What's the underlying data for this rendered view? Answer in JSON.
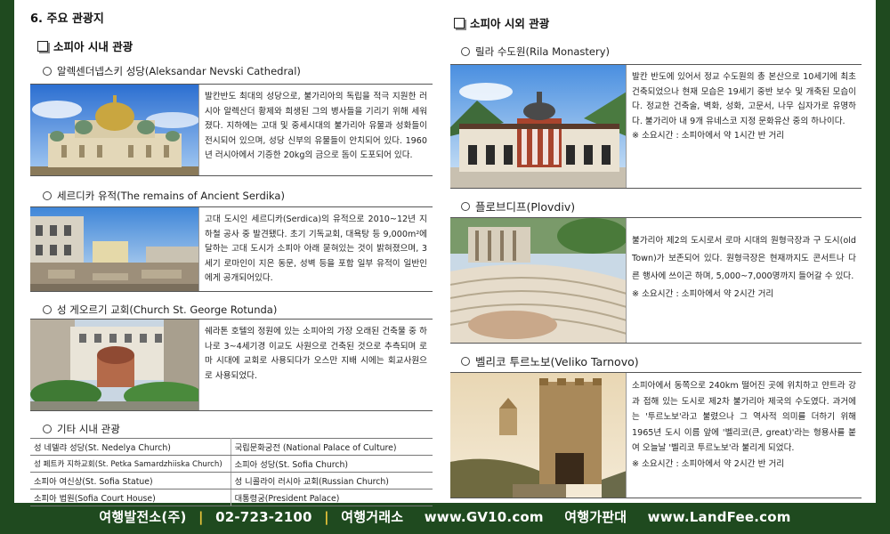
{
  "left": {
    "section_title": "6. 주요 관광지",
    "sub_title": "소피아 시내 관광",
    "items": [
      {
        "title": "알렉센더넵스키 성당(Aleksandar Nevski Cathedral)",
        "desc": "발칸반도 최대의 성당으로, 불가리아의 독립을 적극 지원한 러시아 알렉산더 황제와 희생된 그의 병사들을 기리기 위해 세워졌다. 지하에는 고대 및 중세시대의 불가리아 유물과 성화들이 전시되어 있으며, 성당 신부의 유물들이 안치되어 있다. 1960년 러시아에서 기증한 20kg의 금으로 돔이 도포되어 있다."
      },
      {
        "title": "세르디카 유적(The remains of Ancient Serdika)",
        "desc": "고대 도시인 세르디카(Serdica)의 유적으로 2010~12년 지하철 공사 중 발견됐다. 초기 기독교회, 대욕탕 등 9,000m²에 달하는 고대 도시가 소피아 아래 묻혀있는 것이 밝혀졌으며, 3세기 로마인이 지은 동문, 성벽 등을 포함 일부 유적이 일반인에게 공개되어있다."
      },
      {
        "title": "성 게오르기 교회(Church St. George Rotunda)",
        "desc": "쉐라톤 호텔의 정원에 있는 소피아의 가장 오래된 건축물 중 하나로 3~4세기경 이교도 사원으로 건축된 것으로 추측되며 로마 시대에 교회로 사용되다가 오스만 지배 시에는 회교사원으로 사용되었다."
      }
    ],
    "etc_title": "기타 시내 관광",
    "etc_rows": [
      [
        "성 네델랴 성당(St. Nedelya Church)",
        "국립문화궁전 (National Palace of Culture)"
      ],
      [
        "성 페트카 지하교회(St. Petka Samardzhiiska Church)",
        "소피아 성당(St. Sofia Church)"
      ],
      [
        "소피아 여신상(St. Sofia Statue)",
        "성 니콜라이 러시아 교회(Russian Church)"
      ],
      [
        "소피아 법원(Sofia Court House)",
        "대통령궁(President Palace)"
      ]
    ]
  },
  "right": {
    "sub_title": "소피아 시외 관광",
    "items": [
      {
        "title": "릴라 수도원(Rila Monastery)",
        "desc": "발칸 반도에 있어서 정교 수도원의 총 본산으로 10세기에 최초 건축되었으나 현재 모습은 19세기 중반 보수 및 개축된 모습이다. 정교한 건축술, 벽화, 성화, 고문서, 나무 십자가로 유명하다. 불가리아 내 9개 유네스코 지정 문화유산 중의 하나이다.",
        "note": "※ 소요시간 : 소피아에서 약 1시간 반 거리"
      },
      {
        "title": "플로브디프(Plovdiv)",
        "desc": "불가리아 제2의 도시로서 로마 시대의 원형극장과 구 도시(old Town)가 보존되어 있다. 원형극장은 현재까지도 콘서트나 다른 행사에 쓰이곤 하며, 5,000~7,000명까지 들어갈 수 있다.",
        "note": "※ 소요시간 : 소피아에서 약 2시간 거리"
      },
      {
        "title": "벨리코 투르노보(Veliko Tarnovo)",
        "desc": "소피아에서 동쪽으로 240km 떨어진 곳에 위치하고 얀트라 강과 접해 있는 도시로 제2차 불가리아 제국의 수도였다. 과거에는 '투르노보'라고 불렸으나 그 역사적 의미를 더하기 위해 1965년 도시 이름 앞에 '벨리코(큰, great)'라는 형용사를 붙여 오늘날 '벨리코 투르노보'라 불리게 되었다.",
        "note": "※ 소요시간 : 소피아에서 약 2시간 반 거리"
      }
    ]
  },
  "footer": {
    "company": "여행발전소(주)",
    "phone": "02-723-2100",
    "exchange_label": "여행거래소",
    "exchange_url": "www.GV10.com",
    "price_label": "여행가판대",
    "price_url": "www.LandFee.com",
    "separator": "|"
  }
}
